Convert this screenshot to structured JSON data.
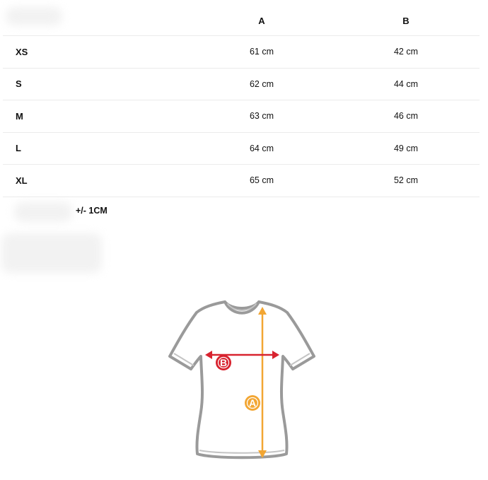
{
  "table": {
    "headers": {
      "label": "",
      "col_a": "A",
      "col_b": "B"
    },
    "rows": [
      {
        "size": "XS",
        "a": "61 cm",
        "b": "42 cm"
      },
      {
        "size": "S",
        "a": "62 cm",
        "b": "44 cm"
      },
      {
        "size": "M",
        "a": "63 cm",
        "b": "46 cm"
      },
      {
        "size": "L",
        "a": "64 cm",
        "b": "49 cm"
      },
      {
        "size": "XL",
        "a": "65 cm",
        "b": "52 cm"
      }
    ]
  },
  "tolerance": "+/- 1CM",
  "diagram": {
    "marker_a": "A",
    "marker_b": "B",
    "colors": {
      "outline": "#9a9a9a",
      "marker_a": "#f2a633",
      "marker_b": "#d8232f"
    }
  }
}
